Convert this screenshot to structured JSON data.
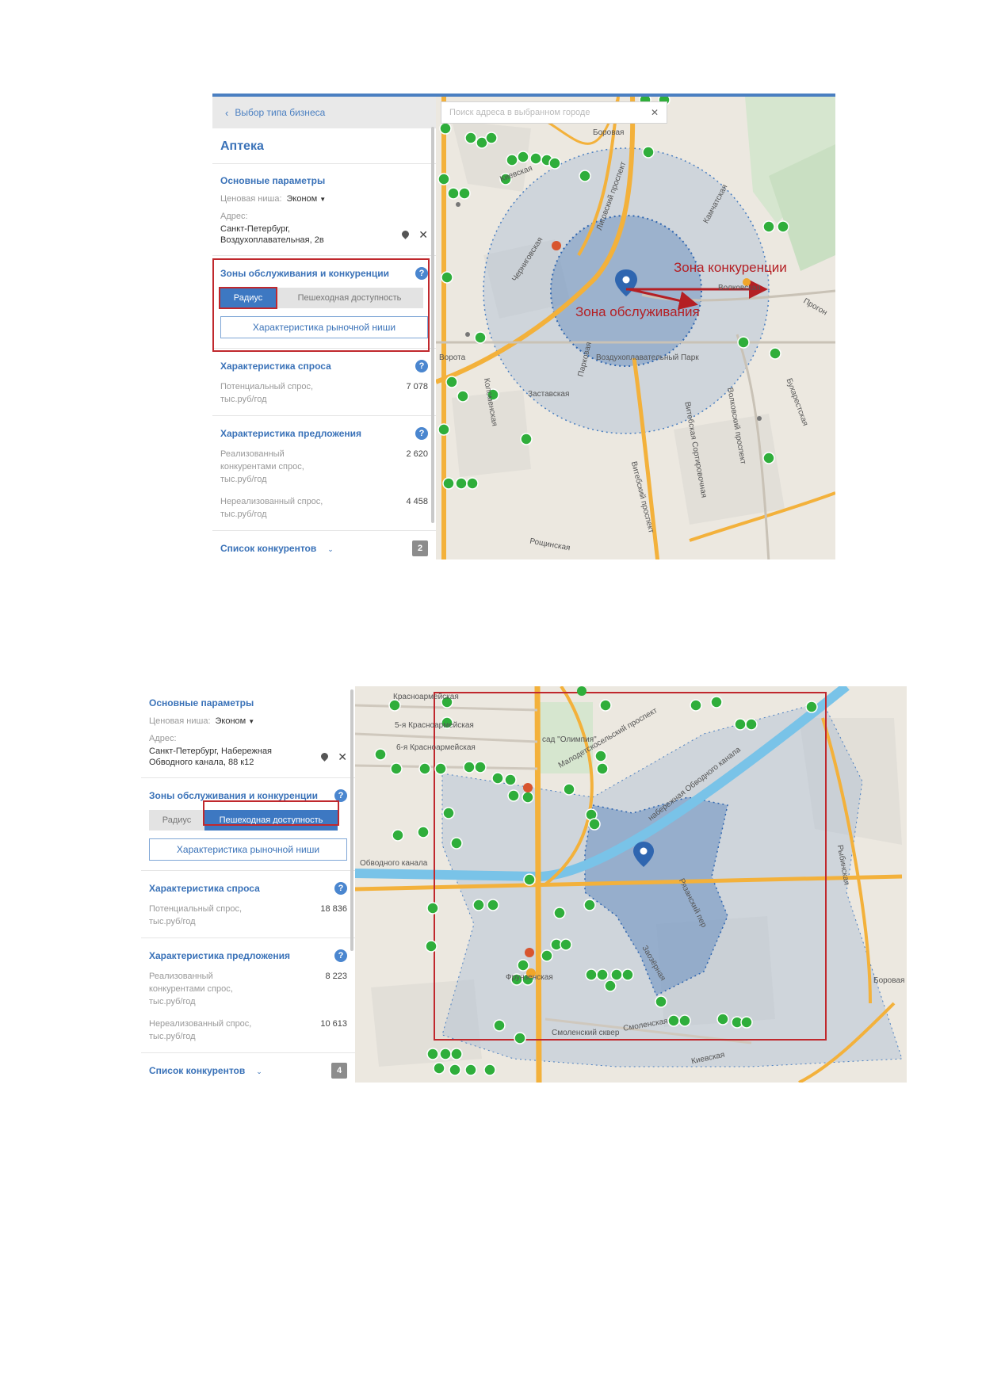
{
  "screenshot1": {
    "back_link": "Выбор типа бизнеса",
    "business_title": "Аптека",
    "basic_params": {
      "heading": "Основные параметры",
      "price_niche_label": "Ценовая ниша:",
      "price_niche_value": "Эконом",
      "address_label": "Адрес:",
      "address_line1": "Санкт-Петербург,",
      "address_line2": "Воздухоплавательная, 2в"
    },
    "zones": {
      "heading": "Зоны обслуживания и конкуренции",
      "tab_radius": "Радиус",
      "tab_walk": "Пешеходная доступность",
      "niche_button": "Характеристика рыночной ниши"
    },
    "demand": {
      "heading": "Характеристика спроса",
      "potential_label": "Потенциальный спрос, тыс.руб/год",
      "potential_value": "7 078"
    },
    "supply": {
      "heading": "Характеристика предложения",
      "realized_label": "Реализованный конкурентами спрос, тыс.руб/год",
      "realized_value": "2 620",
      "unrealized_label": "Нереализованный спрос, тыс.руб/год",
      "unrealized_value": "4 458"
    },
    "competitors": {
      "heading": "Список конкурентов",
      "count": "2"
    },
    "map": {
      "search_placeholder": "Поиск адреса в выбранном городе",
      "zone_competition": "Зона конкуренции",
      "zone_service": "Зона обслуживания",
      "labels": {
        "borovaya": "Боровая",
        "kievskaya": "Киевская",
        "lipovy": "Лиговский проспект",
        "chernigovskaya": "Черниговская",
        "kamchatskaya": "Камчатская",
        "volkovskaya": "Волковская",
        "vorota": "Ворота",
        "parkovaya": "Парковая",
        "vozduhopark": "Воздухоплавательный Парк",
        "zastavskaya": "Заставская",
        "kolomenskaya": "Коломенская",
        "vitebsky_sort": "Витебская Сортировочная",
        "volkovsky_pr": "Волковский проспект",
        "vitebsky_pr": "Витебский проспект",
        "roshinskaya": "Рощинская",
        "buharestskaya": "Бухарестская",
        "progon": "Прогон"
      }
    },
    "colors": {
      "accent": "#3d78c2",
      "highlight": "#c0282d",
      "pin": "#2fae3b",
      "zone": "#4a7fc1"
    }
  },
  "screenshot2": {
    "basic_params": {
      "heading": "Основные параметры",
      "price_niche_label": "Ценовая ниша:",
      "price_niche_value": "Эконом",
      "address_label": "Адрес:",
      "address_line1": "Санкт-Петербург, Набережная",
      "address_line2": "Обводного канала, 88 к12"
    },
    "zones": {
      "heading": "Зоны обслуживания и конкуренции",
      "tab_radius": "Радиус",
      "tab_walk": "Пешеходная доступность",
      "niche_button": "Характеристика рыночной ниши"
    },
    "demand": {
      "heading": "Характеристика спроса",
      "potential_label": "Потенциальный спрос, тыс.руб/год",
      "potential_value": "18 836"
    },
    "supply": {
      "heading": "Характеристика предложения",
      "realized_label": "Реализованный конкурентами спрос, тыс.руб/год",
      "realized_value": "8 223",
      "unrealized_label": "Нереализованный спрос, тыс.руб/год",
      "unrealized_value": "10 613"
    },
    "competitors": {
      "heading": "Список конкурентов",
      "count": "4"
    },
    "map": {
      "labels": {
        "krasn5": "5-я Красноармейская",
        "krasn6": "6-я Красноармейская",
        "krasn_top": "Красноармейская",
        "obvodny": "Обводного канала",
        "nab_obvodny": "набережная Обводного канала",
        "malodet": "Малодетскосельский проспект",
        "rybinskaya": "Рыбинская",
        "frunzenskaya": "Фрунзенская",
        "smolenskaya": "Смоленская",
        "kievskaya": "Киевская",
        "borovaya": "Боровая",
        "zaozernaya": "Заозёрная",
        "sad": "сад \"Олимпия\"",
        "lazar": "Рязанский пер",
        "skver": "Смоленский сквер"
      }
    }
  }
}
